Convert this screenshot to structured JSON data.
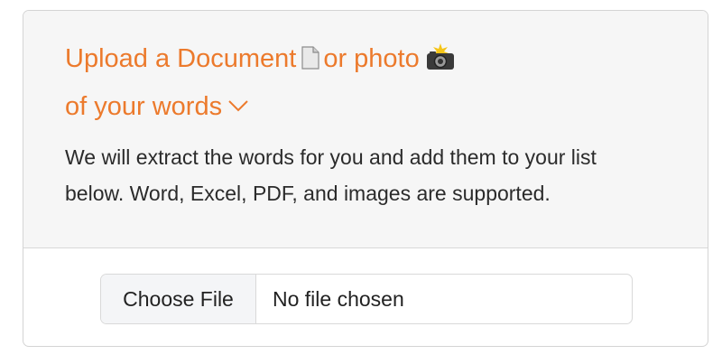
{
  "upload": {
    "heading_part1": "Upload a Document",
    "heading_part2": "or photo",
    "heading_line2": "of your words",
    "document_icon": "document-icon",
    "camera_icon": "camera-flash-icon",
    "chevron_icon": "chevron-down-icon",
    "accent_color": "#ec7a2c",
    "description_line1": "We will extract the words for you and add them to your list",
    "description_line2": "below. Word, Excel, PDF, and images are supported."
  },
  "file_input": {
    "button_label": "Choose File",
    "status": "No file chosen"
  }
}
